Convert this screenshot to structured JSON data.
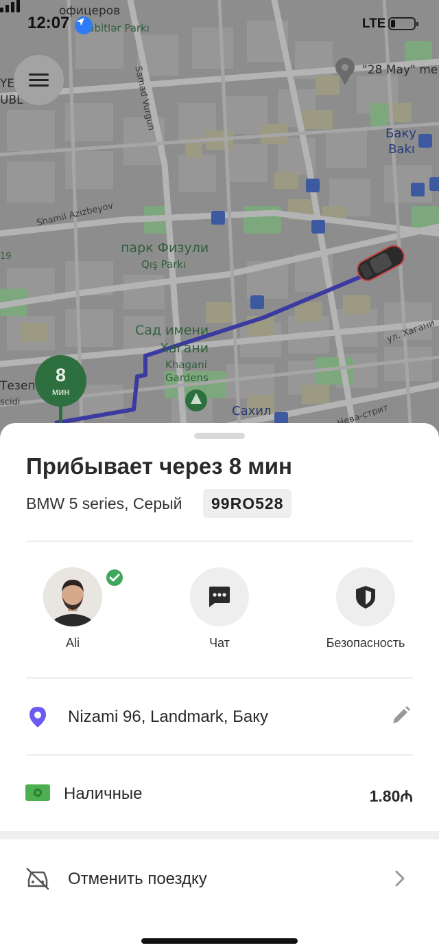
{
  "status_bar": {
    "time": "12:07",
    "network": "LTE",
    "location_icon": "location-arrow-icon",
    "battery_level": 0.2
  },
  "map": {
    "menu_icon": "hamburger-menu-icon",
    "labels": {
      "ofitserov": "офицеров",
      "zabitler": "Zabitlər Parkı",
      "samad_vurgun": "Samad Vurgun",
      "may28": "\"28 May\" me",
      "baku_ru": "Баку",
      "baku_az": "Bakı",
      "shamil": "Shamil Azizbeyov",
      "park_fizuli": "парк Физули",
      "qis_parki": "Qış Parkı",
      "sad_imeni": "Сад имени",
      "khagani_ru": "Хагани",
      "khagani_en": "Khagani",
      "gardens": "Gardens",
      "sahil": "Сахил",
      "ul_khagani": "ул. Хагани",
      "tezepir": "Тезепи",
      "scidi": "scidi",
      "neva": "Нева-стрит",
      "num19": "19",
      "edge_ye": "YE",
      "edge_ubl": "UBL"
    },
    "eta_badge": {
      "number": "8",
      "unit": "мин"
    },
    "route_color": "#3a3aa0",
    "park_color": "#7da77c"
  },
  "sheet": {
    "title": "Прибывает через 8 мин",
    "car": "BMW 5 series, Серый",
    "plate": "99RO528",
    "actions": [
      {
        "label": "Ali",
        "icon": "driver-avatar"
      },
      {
        "label": "Чат",
        "icon": "chat-icon"
      },
      {
        "label": "Безопасность",
        "icon": "shield-icon"
      }
    ],
    "destination": "Nizami 96, Landmark, Баку",
    "payment": "Наличные",
    "price": "1.80₼",
    "cancel": "Отменить поездку"
  },
  "colors": {
    "accent_pin": "#6a5cf0",
    "verified": "#3fa65d",
    "cash": "#4caf50"
  }
}
